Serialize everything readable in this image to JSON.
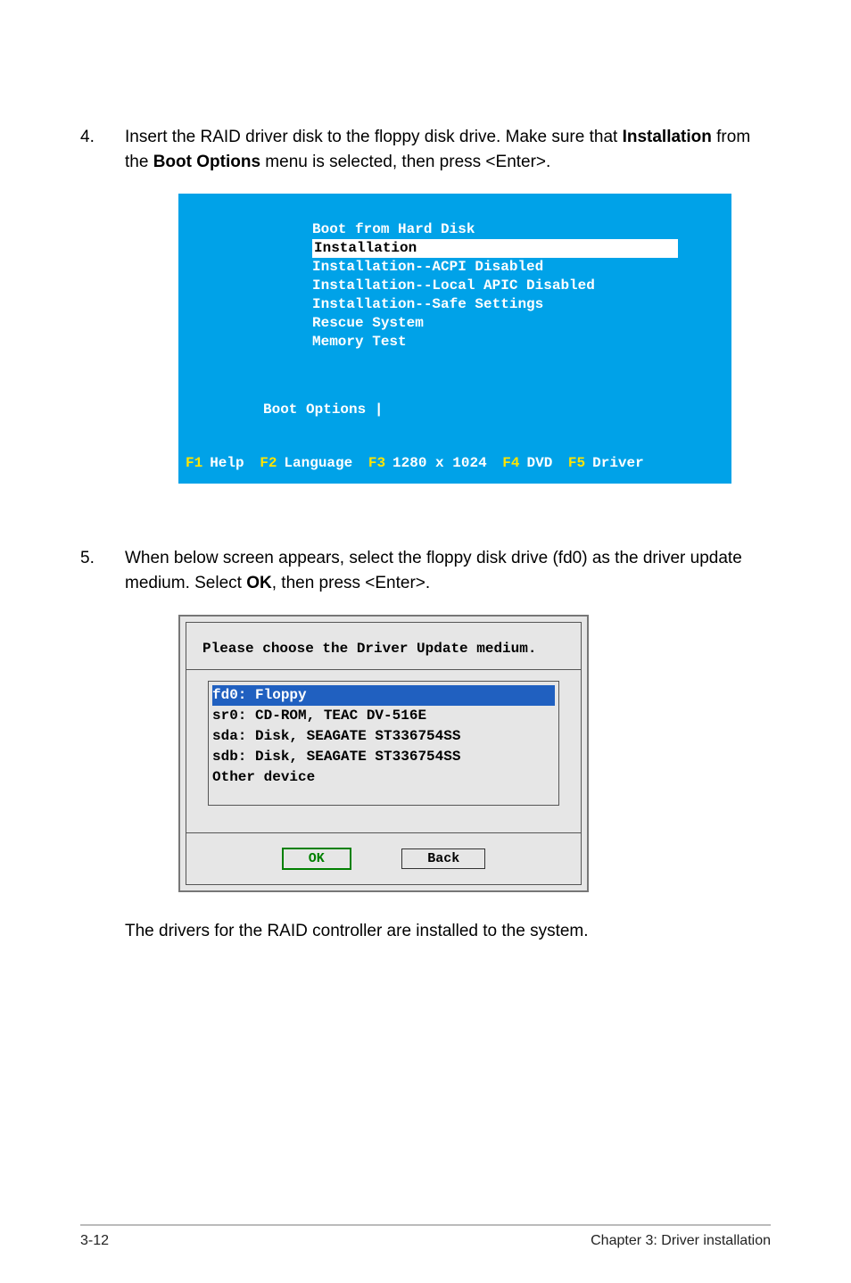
{
  "step4": {
    "num": "4.",
    "text_pre": "Insert the RAID driver disk to the floppy disk drive. Make sure that ",
    "text_bold1": "Installation",
    "text_mid": " from the ",
    "text_bold2": "Boot Options",
    "text_post": " menu is selected, then press <Enter>."
  },
  "boot": {
    "items": [
      "Boot from Hard Disk",
      "Installation",
      "Installation--ACPI Disabled",
      "Installation--Local APIC Disabled",
      "Installation--Safe Settings",
      "Rescue System",
      "Memory Test"
    ],
    "selected_index": "1",
    "options_label": "Boot Options |",
    "fkeys": {
      "k1": "F1",
      "t1": "Help",
      "k2": "F2",
      "t2": "Language",
      "k3": "F3",
      "t3": "1280 x 1024",
      "k4": "F4",
      "t4": "DVD",
      "k5": "F5",
      "t5": "Driver"
    }
  },
  "step5": {
    "num": "5.",
    "text_pre": "When below screen appears, select the floppy disk drive (fd0) as the driver update medium. Select ",
    "text_bold": "OK",
    "text_post": ", then press <Enter>."
  },
  "dialog": {
    "title": "Please choose the Driver Update medium.",
    "items": [
      "fd0: Floppy",
      "sr0: CD-ROM, TEAC DV-516E",
      "sda: Disk, SEAGATE ST336754SS",
      "sdb: Disk, SEAGATE ST336754SS",
      "Other device"
    ],
    "selected_index": "0",
    "ok": "OK",
    "back": "Back"
  },
  "final": "The drivers for the RAID controller are installed to the system.",
  "footer": {
    "left": "3-12",
    "right": "Chapter 3: Driver installation"
  }
}
